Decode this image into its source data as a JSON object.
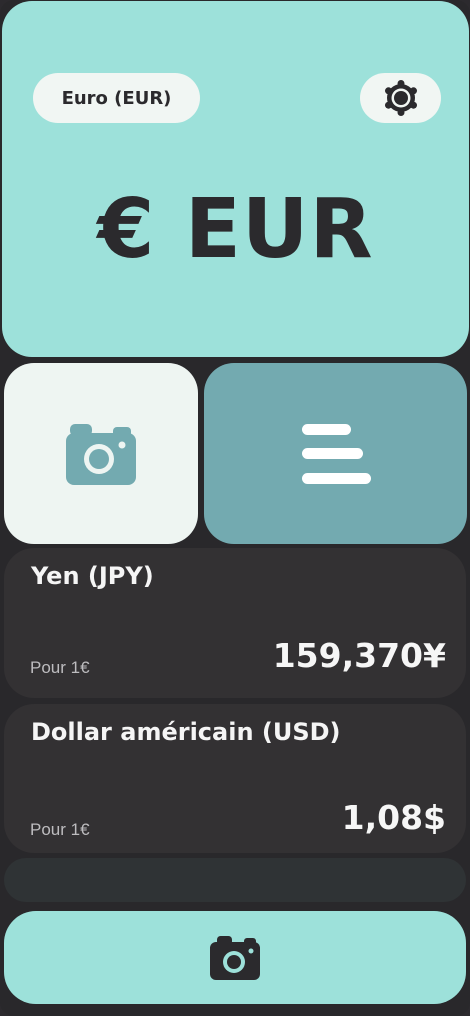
{
  "header": {
    "base_currency_label": "Euro (EUR)",
    "settings_icon": "settings-icon",
    "title": "€ EUR"
  },
  "actions": {
    "camera_icon": "camera-icon",
    "list_icon": "menu-lines-icon"
  },
  "conversions": [
    {
      "name": "Yen (JPY)",
      "sub": "Pour 1€",
      "value": "159,370¥"
    },
    {
      "name": "Dollar américain (USD)",
      "sub": "Pour 1€",
      "value": "1,08$"
    }
  ],
  "footer": {
    "camera_icon": "camera-icon"
  },
  "colors": {
    "accent": "#9de1da",
    "accent_dark": "#73aab0",
    "card": "#333133",
    "background": "#29282b",
    "text_dark": "#2b2a2d"
  }
}
